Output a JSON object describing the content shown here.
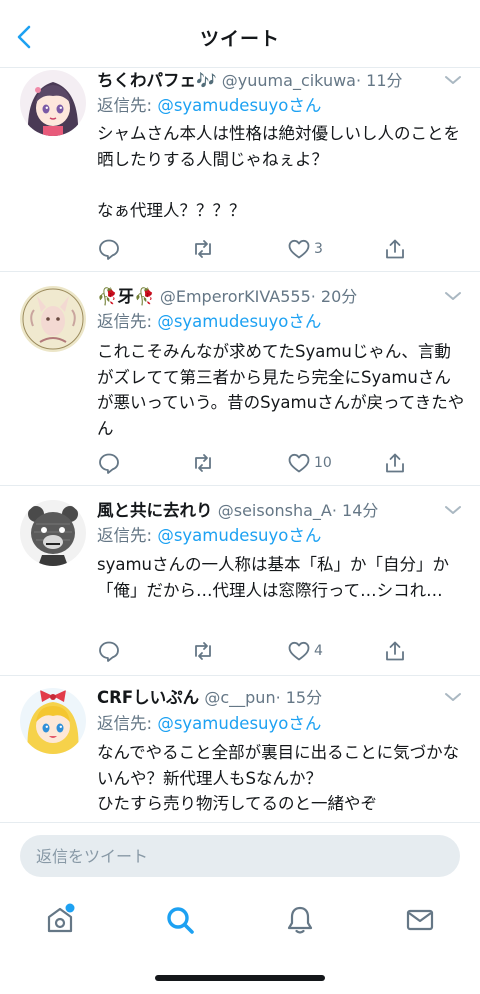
{
  "header": {
    "title": "ツイート",
    "back_icon": "chevron-left-icon"
  },
  "colors": {
    "accent": "#1da1f2",
    "secondary_text": "#657786",
    "divider": "#e6ecf0"
  },
  "tweets": [
    {
      "name": "ちくわパフェ🎶",
      "handle": "@yuuma_cikuwa",
      "time": "· 11分",
      "reply_prefix": "返信先:",
      "reply_to": "@syamudesuyoさん",
      "text": "シャムさん本人は性格は絶対優しいし人のことを晒したりする人間じゃねぇよ？\n\nなぁ代理人？？？？",
      "reply_count": "",
      "retweet_count": "",
      "like_count": "3"
    },
    {
      "name": "🥀牙🥀",
      "handle": "@EmperorKIVA555",
      "time": "· 20分",
      "reply_prefix": "返信先:",
      "reply_to": "@syamudesuyoさん",
      "text": "これこそみんなが求めてたSyamuじゃん、言動がズレてて第三者から見たら完全にSyamuさんが悪いっていう。昔のSyamuさんが戻ってきたやん",
      "reply_count": "",
      "retweet_count": "",
      "like_count": "10"
    },
    {
      "name": "風と共に去れり",
      "handle": "@seisonsha_A",
      "time": "· 14分",
      "reply_prefix": "返信先:",
      "reply_to": "@syamudesuyoさん",
      "text": "syamuさんの一人称は基本「私」か「自分」か「俺」だから…代理人は窓際行って…シコれ…",
      "reply_count": "",
      "retweet_count": "",
      "like_count": "4"
    },
    {
      "name": "CRFしいぷん",
      "handle": "@c__pun",
      "time": "· 15分",
      "reply_prefix": "返信先:",
      "reply_to": "@syamudesuyoさん",
      "text": "なんでやること全部が裏目に出ることに気づかないんや？新代理人もSなんか？\nひたすら売り物汚してるのと一緒やぞ",
      "reply_count": "",
      "retweet_count": "",
      "like_count": ""
    }
  ],
  "compose": {
    "placeholder": "返信をツイート",
    "value": ""
  },
  "tabbar": {
    "items": [
      {
        "icon": "home-icon",
        "active": false,
        "has_notification_dot": true
      },
      {
        "icon": "search-icon",
        "active": true
      },
      {
        "icon": "bell-icon",
        "active": false
      },
      {
        "icon": "mail-icon",
        "active": false
      }
    ]
  }
}
